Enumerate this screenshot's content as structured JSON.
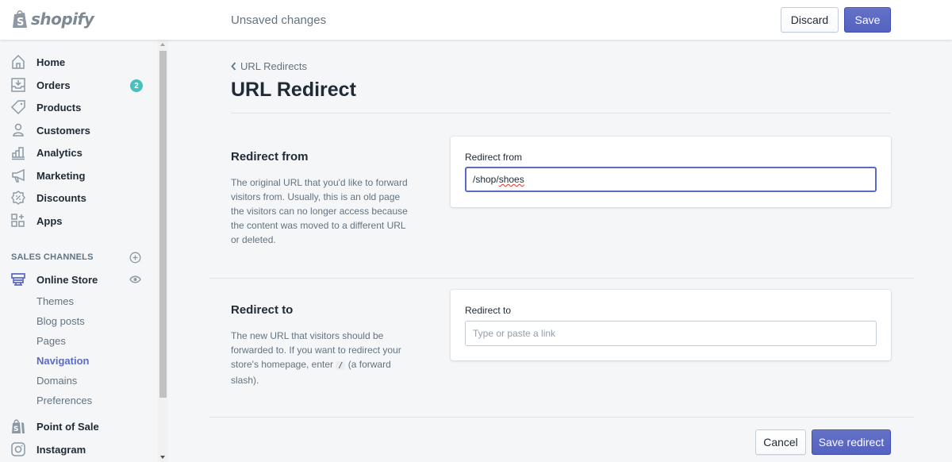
{
  "app": {
    "brand": "shopify",
    "colors": {
      "accent": "#5c6ac4",
      "badge": "#47c1bf",
      "background": "#f4f6f8"
    }
  },
  "topbar": {
    "status": "Unsaved changes",
    "discard_label": "Discard",
    "save_label": "Save"
  },
  "sidebar": {
    "items": [
      {
        "label": "Home",
        "icon": "home-icon"
      },
      {
        "label": "Orders",
        "icon": "orders-icon",
        "badge": "2"
      },
      {
        "label": "Products",
        "icon": "tag-icon"
      },
      {
        "label": "Customers",
        "icon": "customer-icon"
      },
      {
        "label": "Analytics",
        "icon": "analytics-icon"
      },
      {
        "label": "Marketing",
        "icon": "megaphone-icon"
      },
      {
        "label": "Discounts",
        "icon": "discount-icon"
      },
      {
        "label": "Apps",
        "icon": "apps-icon"
      }
    ],
    "sales_channels": {
      "title": "SALES CHANNELS",
      "online_store": {
        "label": "Online Store",
        "sub_items": [
          "Themes",
          "Blog posts",
          "Pages",
          "Navigation",
          "Domains",
          "Preferences"
        ],
        "active": "Navigation"
      },
      "other": [
        {
          "label": "Point of Sale",
          "icon": "pos-icon"
        },
        {
          "label": "Instagram",
          "icon": "instagram-icon"
        }
      ]
    }
  },
  "page": {
    "breadcrumb": "URL Redirects",
    "title": "URL Redirect",
    "redirect_from": {
      "section_title": "Redirect from",
      "description": "The original URL that you'd like to forward visitors from. Usually, this is an old page the visitors can no longer access because the content was moved to a different URL or deleted.",
      "field_label": "Redirect from",
      "value": "/shop/shoes",
      "value_prefix": "/shop/",
      "value_suffix": "shoes"
    },
    "redirect_to": {
      "section_title": "Redirect to",
      "description_before": "The new URL that visitors should be forwarded to. If you want to redirect your store's homepage, enter ",
      "description_code": "/",
      "description_after": " (a forward slash).",
      "field_label": "Redirect to",
      "value": "",
      "placeholder": "Type or paste a link"
    },
    "footer": {
      "cancel_label": "Cancel",
      "save_label": "Save redirect"
    }
  }
}
